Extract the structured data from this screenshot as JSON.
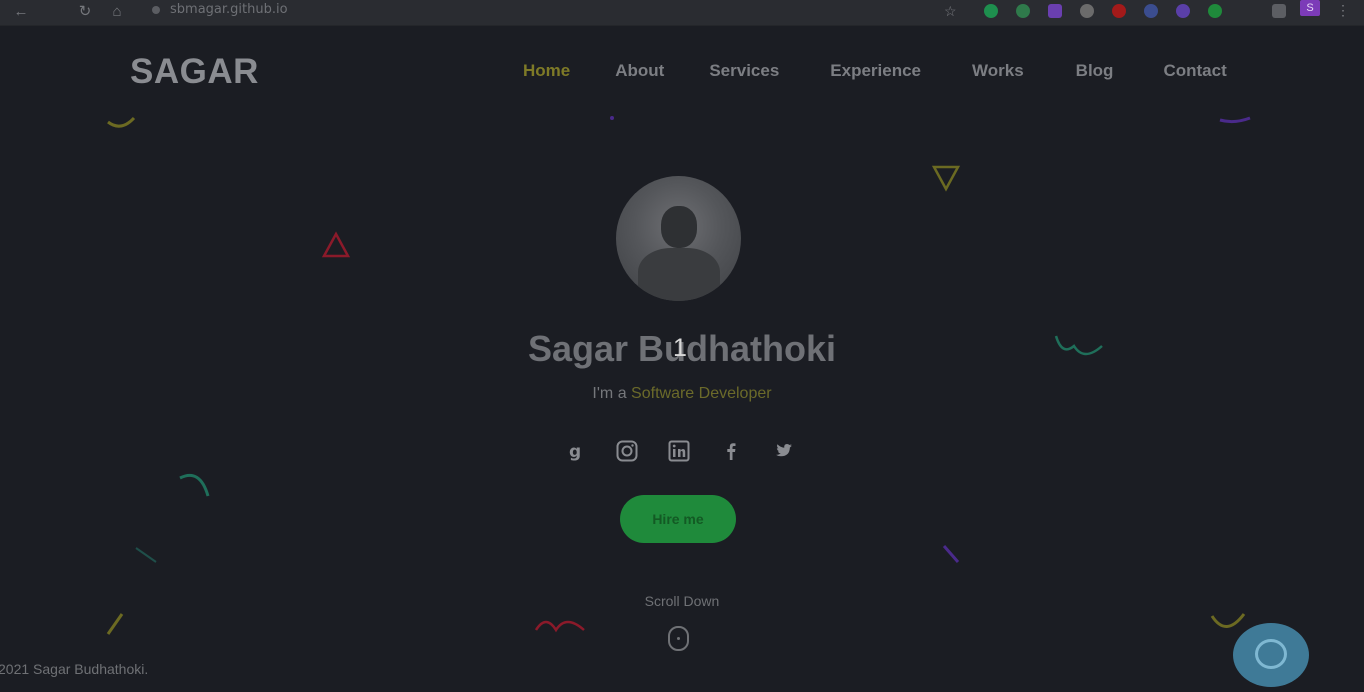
{
  "browser": {
    "url": "sbmagar.github.io",
    "back_icon": "arrow-left-icon",
    "reload_icon": "reload-icon",
    "home_icon": "home-icon",
    "star_icon": "star-icon",
    "profile_initial": "S",
    "extension_colors": [
      "#1e8f4e",
      "#2f7a4b",
      "#6a3fb0",
      "#6b6b6b",
      "#a31a1a",
      "#3b4d8f",
      "#5a3fa8",
      "#1f8a3b"
    ]
  },
  "site": {
    "logo": "SAGAR",
    "nav": [
      {
        "label": "Home",
        "active": true
      },
      {
        "label": "About",
        "active": false
      },
      {
        "label": "Services",
        "active": false
      },
      {
        "label": "Experience",
        "active": false
      },
      {
        "label": "Works",
        "active": false
      },
      {
        "label": "Blog",
        "active": false
      },
      {
        "label": "Contact",
        "active": false
      }
    ]
  },
  "hero": {
    "name": "Sagar Budhathoki",
    "counter": "1",
    "tagline_prefix": "I'm a ",
    "tagline_role": "Software Developer",
    "socials": [
      {
        "icon": "google-icon"
      },
      {
        "icon": "instagram-icon"
      },
      {
        "icon": "linkedin-icon"
      },
      {
        "icon": "facebook-icon"
      },
      {
        "icon": "twitter-icon"
      }
    ],
    "cta_label": "Hire me",
    "scroll_label": "Scroll Down"
  },
  "footer": {
    "copyright": "2021 Sagar Budhathoki."
  },
  "colors": {
    "background": "#1b1d23",
    "accent_yellow": "#7e7a27",
    "cta_green": "#1f8a3b",
    "chat_blue": "#3f7a97"
  }
}
